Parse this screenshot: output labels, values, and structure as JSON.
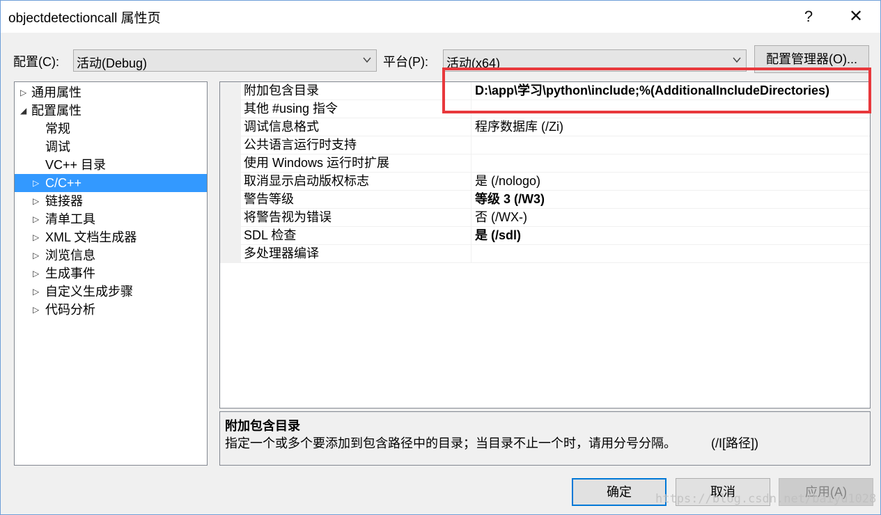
{
  "window": {
    "title": "objectdetectioncall 属性页",
    "help_glyph": "?",
    "close_glyph": "✕"
  },
  "config": {
    "label": "配置(C):",
    "value": "活动(Debug)"
  },
  "platform": {
    "label": "平台(P):",
    "value": "活动(x64)"
  },
  "config_manager_label": "配置管理器(O)...",
  "tree": {
    "items": [
      {
        "label": "通用属性",
        "indent": 0,
        "expander": "▷",
        "selected": false
      },
      {
        "label": "配置属性",
        "indent": 0,
        "expander": "◢",
        "selected": false
      },
      {
        "label": "常规",
        "indent": 1,
        "expander": "",
        "selected": false
      },
      {
        "label": "调试",
        "indent": 1,
        "expander": "",
        "selected": false
      },
      {
        "label": "VC++ 目录",
        "indent": 1,
        "expander": "",
        "selected": false
      },
      {
        "label": "C/C++",
        "indent": 1,
        "expander": "▷",
        "selected": true
      },
      {
        "label": "链接器",
        "indent": 1,
        "expander": "▷",
        "selected": false
      },
      {
        "label": "清单工具",
        "indent": 1,
        "expander": "▷",
        "selected": false
      },
      {
        "label": "XML 文档生成器",
        "indent": 1,
        "expander": "▷",
        "selected": false
      },
      {
        "label": "浏览信息",
        "indent": 1,
        "expander": "▷",
        "selected": false
      },
      {
        "label": "生成事件",
        "indent": 1,
        "expander": "▷",
        "selected": false
      },
      {
        "label": "自定义生成步骤",
        "indent": 1,
        "expander": "▷",
        "selected": false
      },
      {
        "label": "代码分析",
        "indent": 1,
        "expander": "▷",
        "selected": false
      }
    ]
  },
  "properties": [
    {
      "name": "附加包含目录",
      "value": "D:\\app\\学习\\python\\include;%(AdditionalIncludeDirectories)",
      "bold": true
    },
    {
      "name": "其他 #using 指令",
      "value": "",
      "bold": false
    },
    {
      "name": "调试信息格式",
      "value": "程序数据库 (/Zi)",
      "bold": false
    },
    {
      "name": "公共语言运行时支持",
      "value": "",
      "bold": false
    },
    {
      "name": "使用 Windows 运行时扩展",
      "value": "",
      "bold": false
    },
    {
      "name": "取消显示启动版权标志",
      "value": "是 (/nologo)",
      "bold": false
    },
    {
      "name": "警告等级",
      "value": "等级 3 (/W3)",
      "bold": true
    },
    {
      "name": "将警告视为错误",
      "value": "否 (/WX-)",
      "bold": false
    },
    {
      "name": "SDL 检查",
      "value": "是 (/sdl)",
      "bold": true
    },
    {
      "name": "多处理器编译",
      "value": "",
      "bold": false
    }
  ],
  "description": {
    "title": "附加包含目录",
    "text": "指定一个或多个要添加到包含路径中的目录；当目录不止一个时，请用分号分隔。",
    "switch": "(/I[路径])"
  },
  "buttons": {
    "ok": "确定",
    "cancel": "取消",
    "apply": "应用(A)"
  },
  "watermark": "https://blog.csdn.net/baiyu1028",
  "colors": {
    "selection": "#3399ff",
    "highlight_box": "#e8383c",
    "primary_border": "#0078d7"
  }
}
